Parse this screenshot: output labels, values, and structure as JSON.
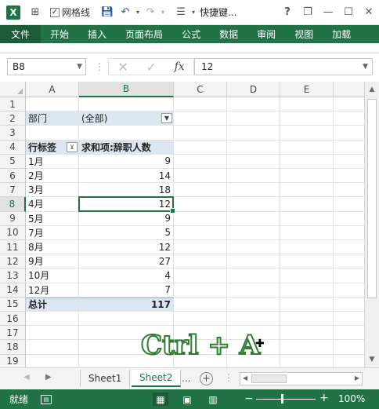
{
  "titlebar": {
    "app_icon": "X",
    "gridlines_label": "网格线",
    "gridlines_checked": "✓",
    "quick_label": "快捷键...",
    "help": "?",
    "minimize": "—",
    "restore": "❐",
    "close": "✕"
  },
  "ribbon": {
    "tabs": [
      "文件",
      "开始",
      "插入",
      "页面布局",
      "公式",
      "数据",
      "审阅",
      "视图",
      "加载"
    ]
  },
  "formula_bar": {
    "name_box": "B8",
    "formula": "12",
    "fx": "fx",
    "cancel": "✕",
    "enter": "✓"
  },
  "grid": {
    "columns": [
      "A",
      "B",
      "C",
      "D",
      "E"
    ],
    "rows": [
      "1",
      "2",
      "3",
      "4",
      "5",
      "6",
      "7",
      "8",
      "9",
      "10",
      "11",
      "12",
      "13",
      "14",
      "15",
      "16",
      "17",
      "18",
      "19"
    ],
    "filter": {
      "label": "部门",
      "value": "(全部)"
    },
    "pivot_header": {
      "row_label": "行标签",
      "value_label": "求和项:辞职人数"
    },
    "pivot_rows": [
      {
        "month": "1月",
        "value": "9"
      },
      {
        "month": "2月",
        "value": "14"
      },
      {
        "month": "3月",
        "value": "18"
      },
      {
        "month": "4月",
        "value": "12"
      },
      {
        "month": "5月",
        "value": "9"
      },
      {
        "month": "7月",
        "value": "5"
      },
      {
        "month": "8月",
        "value": "12"
      },
      {
        "month": "9月",
        "value": "27"
      },
      {
        "month": "10月",
        "value": "4"
      },
      {
        "month": "12月",
        "value": "7"
      }
    ],
    "total": {
      "label": "总计",
      "value": "117"
    },
    "active_cell": "B8"
  },
  "overlay": {
    "shortcut": "Ctrl + A",
    "cursor": "✚"
  },
  "sheets": {
    "tabs": [
      "Sheet1",
      "Sheet2"
    ],
    "active": "Sheet2",
    "more": "...",
    "add": "+"
  },
  "statusbar": {
    "ready": "就绪",
    "zoom": "100%",
    "minus": "−",
    "plus": "+"
  },
  "colors": {
    "accent": "#217346",
    "header_fill": "#dce6f1"
  }
}
